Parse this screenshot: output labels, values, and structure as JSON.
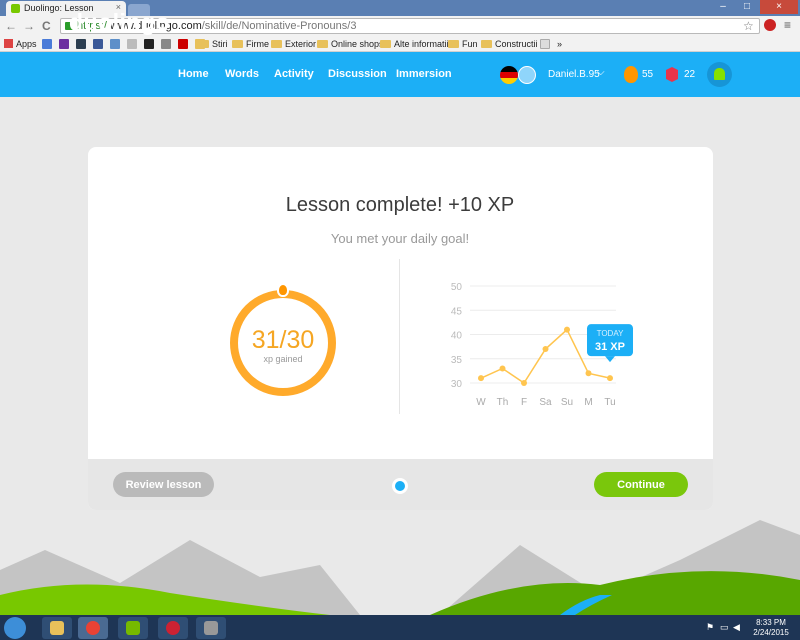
{
  "browser": {
    "tab_title": "Duolingo: Lesson",
    "tab_close": "×",
    "window_min": "–",
    "window_max": "□",
    "window_close": "×",
    "nav_back": "←",
    "nav_forward": "→",
    "nav_reload": "C",
    "url_scheme": "https://",
    "url_host": "www.duolingo.com",
    "url_path": "/skill/de/Nominative-Pronouns/3",
    "star": "☆",
    "menu": "≡",
    "bookmarks": [
      {
        "label": "Apps",
        "type": "apps"
      },
      {
        "label": "Stiri",
        "type": "folder"
      },
      {
        "label": "Firme",
        "type": "folder"
      },
      {
        "label": "Exterior",
        "type": "folder"
      },
      {
        "label": "Online shops",
        "type": "folder"
      },
      {
        "label": "Alte informatii",
        "type": "folder"
      },
      {
        "label": "Fun",
        "type": "folder"
      },
      {
        "label": "Constructii",
        "type": "folder"
      },
      {
        "label": "»",
        "type": "more"
      }
    ]
  },
  "header": {
    "logo": "duolingo",
    "nav": [
      "Home",
      "Words",
      "Activity",
      "Discussion",
      "Immersion"
    ],
    "username": "Daniel.B.95",
    "dropdown": "⌵",
    "streak": "55",
    "lingots": "22"
  },
  "lesson": {
    "title": "Lesson complete! +10 XP",
    "subtitle": "You met your daily goal!",
    "xp_value": "31/30",
    "xp_label": "xp gained",
    "review_label": "Review lesson",
    "continue_label": "Continue"
  },
  "chart_data": {
    "type": "line",
    "categories": [
      "W",
      "Th",
      "F",
      "Sa",
      "Su",
      "M",
      "Tu"
    ],
    "values": [
      31,
      33,
      30,
      37,
      41,
      32,
      31
    ],
    "ylim": [
      30,
      50
    ],
    "yticks": [
      50,
      45,
      40,
      35,
      30
    ],
    "grid": true,
    "color": "#ffc54f",
    "tooltip": {
      "label": "TODAY",
      "value": "31 XP",
      "index": 6
    }
  },
  "taskbar": {
    "time": "8:33 PM",
    "date": "2/24/2015"
  }
}
